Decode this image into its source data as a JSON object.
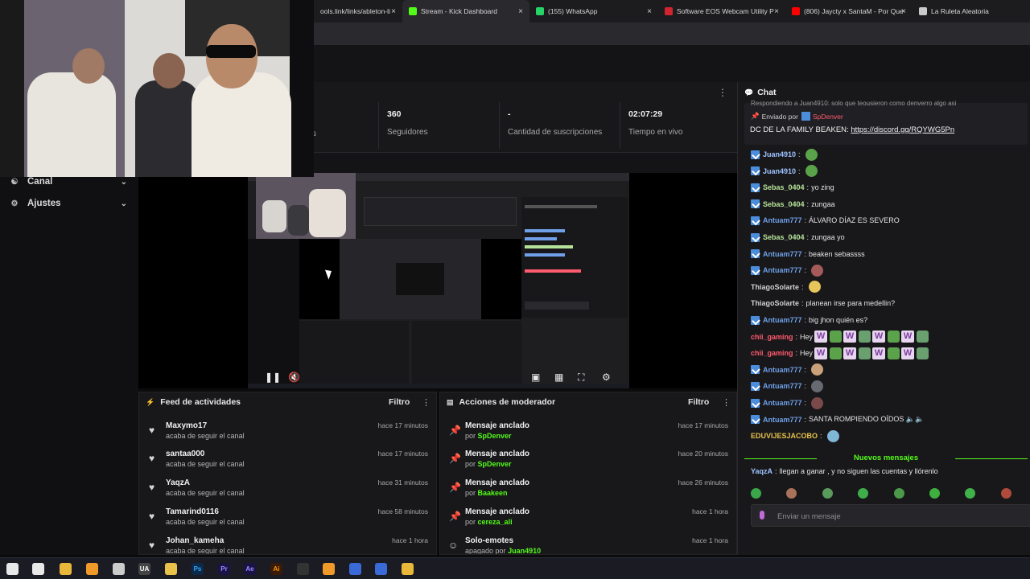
{
  "browser": {
    "tabs": [
      {
        "label": "ools.link/links/ableton-li",
        "icon_color": "#6b7cff"
      },
      {
        "label": "Stream - Kick Dashboard",
        "icon_color": "#53fc18",
        "active": true
      },
      {
        "label": "(155) WhatsApp",
        "icon_color": "#25d366"
      },
      {
        "label": "Software EOS Webcam Utility P",
        "icon_color": "#d1242f"
      },
      {
        "label": "(806) Jaycty x SantaM - Por Que",
        "icon_color": "#ff0000"
      },
      {
        "label": "La Ruleta Aleatoria",
        "icon_color": "#c9c9c9"
      }
    ],
    "close_glyph": "×"
  },
  "sidebar": {
    "items": [
      {
        "label": "Canal",
        "icon": "users-icon"
      },
      {
        "label": "Ajustes",
        "icon": "gear-icon"
      }
    ]
  },
  "stats": {
    "items": [
      {
        "value": "360",
        "label": "Seguidores"
      },
      {
        "value": "-",
        "label": "Cantidad de suscripciones"
      },
      {
        "value": "02:07:29",
        "label": "Tiempo en vivo"
      }
    ],
    "menu_glyph": "⋮"
  },
  "feed": {
    "title": "Feed de actividades",
    "filter_label": "Filtro",
    "rows": [
      {
        "name": "Maxymo17",
        "sub": "acaba de seguir el canal",
        "time": "hace 17 minutos"
      },
      {
        "name": "santaa000",
        "sub": "acaba de seguir el canal",
        "time": "hace 17 minutos"
      },
      {
        "name": "YaqzA",
        "sub": "acaba de seguir el canal",
        "time": "hace 31 minutos"
      },
      {
        "name": "Tamarind0116",
        "sub": "acaba de seguir el canal",
        "time": "hace 58 minutos"
      },
      {
        "name": "Johan_kameha",
        "sub": "acaba de seguir el canal",
        "time": "hace 1 hora"
      }
    ]
  },
  "mod": {
    "title": "Acciones de moderador",
    "filter_label": "Filtro",
    "by_prefix": "por",
    "rows": [
      {
        "action": "Mensaje anclado",
        "by": "SpDenver",
        "time": "hace 17 minutos"
      },
      {
        "action": "Mensaje anclado",
        "by": "SpDenver",
        "time": "hace 20 minutos"
      },
      {
        "action": "Mensaje anclado",
        "by": "Baakeen",
        "time": "hace 26 minutos"
      },
      {
        "action": "Mensaje anclado",
        "by": "cereza_ali",
        "time": "hace 1 hora"
      },
      {
        "action": "Solo-emotes",
        "by": "Juan4910",
        "by_prefix": "apagado por",
        "time": "hace 1 hora"
      }
    ]
  },
  "chat": {
    "title": "Chat",
    "pinned_prev": "Respondiendo a Juan4910: solo que teousieron como denverro algo asi",
    "pinned_by_prefix": "Enviado por",
    "pinned_by": "SpDenver",
    "pinned_text": "DC DE LA FAMILY BEAKEN:",
    "pinned_link": "https://discord.gg/RQYWG5Pn",
    "messages": [
      {
        "user": "Juan4910",
        "color": "#9ec3ff",
        "badge": true,
        "text": "",
        "emotes": [
          "#5aa34a"
        ]
      },
      {
        "user": "Juan4910",
        "color": "#9ec3ff",
        "badge": true,
        "text": "",
        "emotes": [
          "#5aa34a"
        ]
      },
      {
        "user": "Sebas_0404",
        "color": "#b6e39a",
        "badge": true,
        "text": "yo zing",
        "emotes": []
      },
      {
        "user": "Sebas_0404",
        "color": "#b6e39a",
        "badge": true,
        "text": "zungaa",
        "emotes": []
      },
      {
        "user": "Antuam777",
        "color": "#6fa0e8",
        "badge": true,
        "text": "ÁLVARO DÍAZ ES SEVERO",
        "emotes": []
      },
      {
        "user": "Sebas_0404",
        "color": "#b6e39a",
        "badge": true,
        "text": "zungaa yo",
        "emotes": []
      },
      {
        "user": "Antuam777",
        "color": "#6fa0e8",
        "badge": true,
        "text": "beaken sebassss",
        "emotes": []
      },
      {
        "user": "Antuam777",
        "color": "#6fa0e8",
        "badge": true,
        "text": "",
        "emotes": [
          "#a55a5a"
        ]
      },
      {
        "user": "ThiagoSolarte",
        "color": "#d0d0d0",
        "badge": false,
        "text": "",
        "emotes": [
          "#e6c65a"
        ]
      },
      {
        "user": "ThiagoSolarte",
        "color": "#d0d0d0",
        "badge": false,
        "text": "planean irse para medellin?",
        "emotes": []
      },
      {
        "user": "Antuam777",
        "color": "#6fa0e8",
        "badge": true,
        "text": "big jhon quién es?",
        "emotes": []
      },
      {
        "user": "chii_gaming",
        "color": "#ff5a6e",
        "badge": false,
        "text": "Hey",
        "wemotes": true
      },
      {
        "user": "chii_gaming",
        "color": "#ff5a6e",
        "badge": false,
        "text": "Hey",
        "wemotes": true
      },
      {
        "user": "Antuam777",
        "color": "#6fa0e8",
        "badge": true,
        "text": "",
        "emotes": [
          "#c9a27a"
        ]
      },
      {
        "user": "Antuam777",
        "color": "#6fa0e8",
        "badge": true,
        "text": "",
        "emotes": [
          "#666a70"
        ]
      },
      {
        "user": "Antuam777",
        "color": "#6fa0e8",
        "badge": true,
        "text": "",
        "emotes": [
          "#7a4a4a"
        ]
      },
      {
        "user": "Antuam777",
        "color": "#6fa0e8",
        "badge": true,
        "text": "SANTA ROMPIENDO OÍDOS 🔈🔈",
        "emotes": []
      },
      {
        "user": "EDUVIJESJACOBO",
        "color": "#e8c24a",
        "badge": false,
        "text": "",
        "emotes": [
          "#7fb7d8"
        ]
      }
    ],
    "new_messages_label": "Nuevos mensajes",
    "after_new": {
      "user": "YaqzA",
      "color": "#9ec3ff",
      "text": "llegan a ganar , y no siguen las cuentas y llórenlo"
    },
    "emote_bar": [
      "#3aa84a",
      "#a8735a",
      "#5a9a5a",
      "#3fae4a",
      "#4a9a4a",
      "#3eb03e",
      "#3fb34a",
      "#b04a3a"
    ],
    "input_placeholder": "Enviar un mensaje"
  },
  "taskbar": {
    "items": [
      {
        "label": "",
        "icon": "windows-start-icon",
        "color": "#e8e8e8"
      },
      {
        "label": "",
        "icon": "task-view-icon",
        "color": "#e8e8e8"
      },
      {
        "label": "",
        "icon": "chrome-icon",
        "color": "#e8b83a"
      },
      {
        "label": "",
        "icon": "fl-studio-icon",
        "color": "#f09a2a"
      },
      {
        "label": "",
        "icon": "webcam-utility-icon",
        "color": "#cccccc"
      },
      {
        "label": "UA",
        "icon": "ua-icon",
        "color": "#444"
      },
      {
        "label": "",
        "icon": "file-explorer-icon",
        "color": "#e8c24a"
      },
      {
        "label": "Ps",
        "icon": "photoshop-icon",
        "color": "#0b2a4a"
      },
      {
        "label": "Pr",
        "icon": "premiere-icon",
        "color": "#1a1444"
      },
      {
        "label": "Ae",
        "icon": "after-effects-icon",
        "color": "#1a1444"
      },
      {
        "label": "Ai",
        "icon": "illustrator-icon",
        "color": "#3a1a08"
      },
      {
        "label": "",
        "icon": "obs-icon",
        "color": "#333"
      },
      {
        "label": "",
        "icon": "fl-studio-icon-2",
        "color": "#f09a2a"
      },
      {
        "label": "",
        "icon": "app-blue-icon",
        "color": "#3a6ad8"
      },
      {
        "label": "",
        "icon": "app-blue-icon-2",
        "color": "#3a6ad8"
      },
      {
        "label": "",
        "icon": "chrome-icon-active",
        "color": "#e8b83a"
      }
    ]
  }
}
